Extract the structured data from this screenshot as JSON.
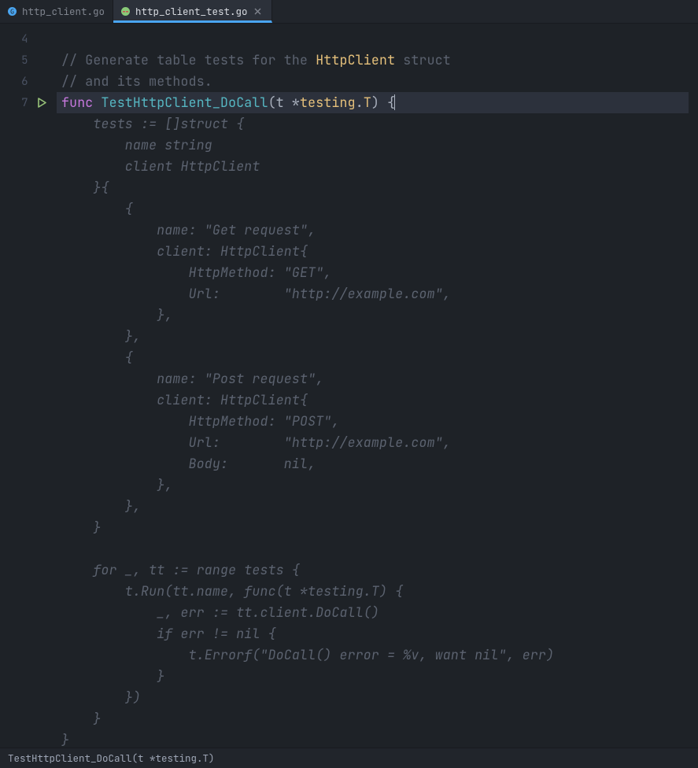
{
  "tabs": [
    {
      "label": "http_client.go",
      "active": false
    },
    {
      "label": "http_client_test.go",
      "active": true
    }
  ],
  "gutter": {
    "line_numbers": [
      "4",
      "5",
      "6",
      "7"
    ],
    "run_on_line": "7"
  },
  "code": {
    "comment1_pre": "// Generate table tests for the ",
    "comment1_struct": "HttpClient",
    "comment1_post": " struct",
    "comment2": "// and its methods.",
    "func_kw": "func ",
    "func_name": "TestHttpClient_DoCall",
    "sig_open": "(t *",
    "sig_pkg": "testing",
    "sig_dot": ".",
    "sig_type": "T",
    "sig_close": ") {",
    "suggestion": [
      "    tests := []struct {",
      "        name string",
      "        client HttpClient",
      "    }{",
      "        {",
      "            name: \"Get request\",",
      "            client: HttpClient{",
      "                HttpMethod: \"GET\",",
      "                Url:        \"http://example.com\",",
      "            },",
      "        },",
      "        {",
      "            name: \"Post request\",",
      "            client: HttpClient{",
      "                HttpMethod: \"POST\",",
      "                Url:        \"http://example.com\",",
      "                Body:       nil,",
      "            },",
      "        },",
      "    }",
      "",
      "    for _, tt := range tests {",
      "        t.Run(tt.name, func(t *testing.T) {",
      "            _, err := tt.client.DoCall()",
      "            if err != nil {",
      "                t.Errorf(\"DoCall() error = %v, want nil\", err)",
      "            }",
      "        })",
      "    }",
      "}"
    ]
  },
  "statusbar": {
    "breadcrumb": "TestHttpClient_DoCall(t *testing.T)"
  },
  "colors": {
    "background": "#1e2227",
    "accent_tab": "#4aa5f0",
    "keyword": "#c678dd",
    "function": "#56b6c2",
    "type": "#e5c07b",
    "comment": "#5c6370",
    "text": "#abb2bf",
    "run_icon": "#98c379"
  }
}
